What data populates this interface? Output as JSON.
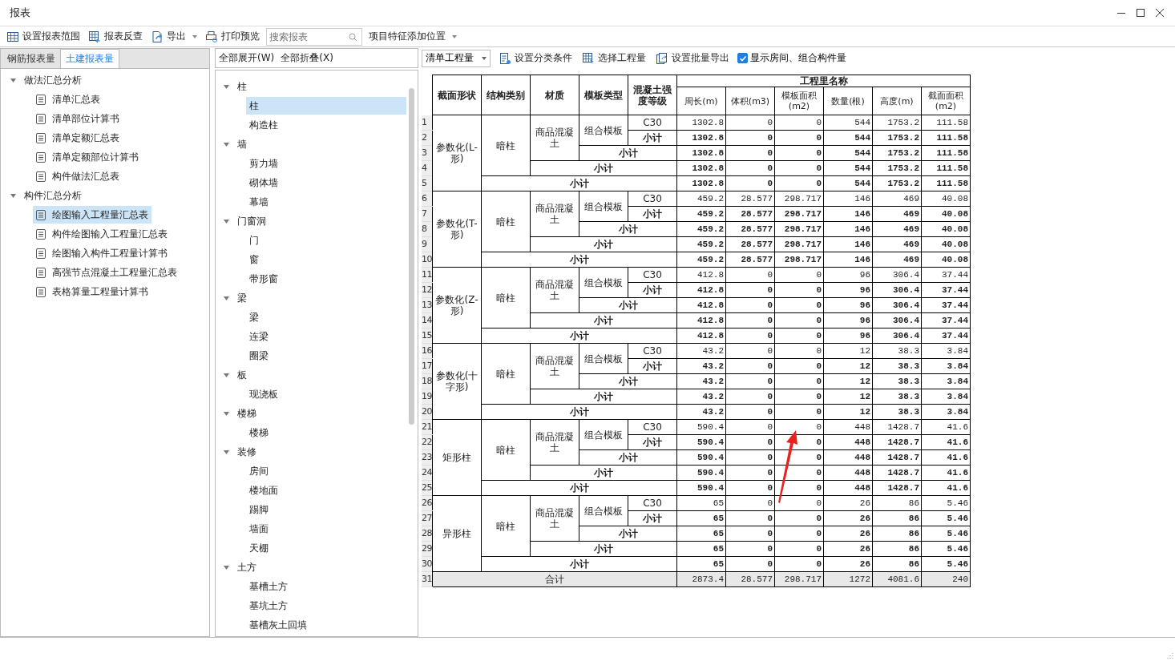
{
  "window": {
    "title": "报表"
  },
  "toolbar": [
    {
      "kind": "button",
      "label": "设置报表范围"
    },
    {
      "kind": "button",
      "label": "报表反查"
    },
    {
      "kind": "menu",
      "label": "导出"
    },
    {
      "kind": "button",
      "label": "打印预览"
    },
    {
      "kind": "search",
      "placeholder": "搜索报表"
    },
    {
      "kind": "dropdown",
      "label": "项目特征添加位置"
    }
  ],
  "left_tabs": [
    {
      "label": "钢筋报表量",
      "selected": false
    },
    {
      "label": "土建报表量",
      "selected": true
    }
  ],
  "report_tree": [
    {
      "label": "做法汇总分析",
      "expanded": true,
      "selected": false,
      "children": [
        {
          "label": "清单汇总表",
          "selected": false
        },
        {
          "label": "清单部位计算书",
          "selected": false
        },
        {
          "label": "清单定额汇总表",
          "selected": false
        },
        {
          "label": "清单定额部位计算书",
          "selected": false
        },
        {
          "label": "构件做法汇总表",
          "selected": false
        }
      ]
    },
    {
      "label": "构件汇总分析",
      "expanded": true,
      "selected": false,
      "children": [
        {
          "label": "绘图输入工程量汇总表",
          "selected": true
        },
        {
          "label": "构件绘图输入工程量汇总表",
          "selected": false
        },
        {
          "label": "绘图输入构件工程量计算书",
          "selected": false
        },
        {
          "label": "高强节点混凝土工程量汇总表",
          "selected": false
        },
        {
          "label": "表格算量工程量计算书",
          "selected": false
        }
      ]
    }
  ],
  "tree_actions": [
    "全部展开(W)",
    "全部折叠(X)"
  ],
  "component_tree": [
    {
      "label": "柱",
      "expanded": true,
      "selected": false,
      "children": [
        {
          "label": "柱",
          "selected": true
        },
        {
          "label": "构造柱",
          "selected": false
        }
      ]
    },
    {
      "label": "墙",
      "expanded": true,
      "selected": false,
      "children": [
        {
          "label": "剪力墙",
          "selected": false
        },
        {
          "label": "砌体墙",
          "selected": false
        },
        {
          "label": "幕墙",
          "selected": false
        }
      ]
    },
    {
      "label": "门窗洞",
      "expanded": true,
      "selected": false,
      "children": [
        {
          "label": "门",
          "selected": false
        },
        {
          "label": "窗",
          "selected": false
        },
        {
          "label": "带形窗",
          "selected": false
        }
      ]
    },
    {
      "label": "梁",
      "expanded": true,
      "selected": false,
      "children": [
        {
          "label": "梁",
          "selected": false
        },
        {
          "label": "连梁",
          "selected": false
        },
        {
          "label": "圈梁",
          "selected": false
        }
      ]
    },
    {
      "label": "板",
      "expanded": true,
      "selected": false,
      "children": [
        {
          "label": "现浇板",
          "selected": false
        }
      ]
    },
    {
      "label": "楼梯",
      "expanded": true,
      "selected": false,
      "children": [
        {
          "label": "楼梯",
          "selected": false
        }
      ]
    },
    {
      "label": "装修",
      "expanded": true,
      "selected": false,
      "children": [
        {
          "label": "房间",
          "selected": false
        },
        {
          "label": "楼地面",
          "selected": false
        },
        {
          "label": "踢脚",
          "selected": false
        },
        {
          "label": "墙面",
          "selected": false
        },
        {
          "label": "天棚",
          "selected": false
        }
      ]
    },
    {
      "label": "土方",
      "expanded": true,
      "selected": false,
      "children": [
        {
          "label": "基槽土方",
          "selected": false
        },
        {
          "label": "基坑土方",
          "selected": false
        },
        {
          "label": "基槽灰土回填",
          "selected": false
        }
      ]
    }
  ],
  "report_toolbar": [
    {
      "kind": "dropdown",
      "label": "清单工程量"
    },
    {
      "kind": "button",
      "label": "设置分类条件"
    },
    {
      "kind": "button",
      "label": "选择工程量"
    },
    {
      "kind": "button",
      "label": "设置批量导出"
    },
    {
      "kind": "checkbox",
      "label": "显示房间、组合构件量",
      "checked": true
    }
  ],
  "table": {
    "columns": [
      "截面形状",
      "结构类别",
      "材质",
      "模板类型",
      "混凝土强度等级"
    ],
    "group_header": "工程里名称",
    "quantity_columns": [
      "周长(m)",
      "体积(m3)",
      "模板面积(m2)",
      "数量(根)",
      "高度(m)",
      "截面面积(m2)"
    ],
    "groups": [
      {
        "shape": "参数化(L-形)",
        "structure": "暗柱",
        "material": "商品混凝土",
        "template": "组合模板",
        "rows": [
          {
            "num": "1",
            "kind": "detail",
            "label": "C30",
            "values": [
              "1302.8",
              "0",
              "0",
              "544",
              "1753.2",
              "111.58"
            ]
          },
          {
            "num": "2",
            "kind": "subtotal",
            "label": "小计",
            "values": [
              "1302.8",
              "0",
              "0",
              "544",
              "1753.2",
              "111.58"
            ]
          },
          {
            "num": "3",
            "kind": "subtotal",
            "label": "小计",
            "values": [
              "1302.8",
              "0",
              "0",
              "544",
              "1753.2",
              "111.58"
            ]
          },
          {
            "num": "4",
            "kind": "subtotal",
            "label": "小计",
            "values": [
              "1302.8",
              "0",
              "0",
              "544",
              "1753.2",
              "111.58"
            ]
          },
          {
            "num": "5",
            "kind": "subtotal",
            "label": "小计",
            "values": [
              "1302.8",
              "0",
              "0",
              "544",
              "1753.2",
              "111.58"
            ]
          }
        ]
      },
      {
        "shape": "参数化(T-形)",
        "structure": "暗柱",
        "material": "商品混凝土",
        "template": "组合模板",
        "rows": [
          {
            "num": "6",
            "kind": "detail",
            "label": "C30",
            "values": [
              "459.2",
              "28.577",
              "298.717",
              "146",
              "469",
              "40.08"
            ]
          },
          {
            "num": "7",
            "kind": "subtotal",
            "label": "小计",
            "values": [
              "459.2",
              "28.577",
              "298.717",
              "146",
              "469",
              "40.08"
            ]
          },
          {
            "num": "8",
            "kind": "subtotal",
            "label": "小计",
            "values": [
              "459.2",
              "28.577",
              "298.717",
              "146",
              "469",
              "40.08"
            ]
          },
          {
            "num": "9",
            "kind": "subtotal",
            "label": "小计",
            "values": [
              "459.2",
              "28.577",
              "298.717",
              "146",
              "469",
              "40.08"
            ]
          },
          {
            "num": "10",
            "kind": "subtotal",
            "label": "小计",
            "values": [
              "459.2",
              "28.577",
              "298.717",
              "146",
              "469",
              "40.08"
            ]
          }
        ]
      },
      {
        "shape": "参数化(Z-形)",
        "structure": "暗柱",
        "material": "商品混凝土",
        "template": "组合模板",
        "rows": [
          {
            "num": "11",
            "kind": "detail",
            "label": "C30",
            "values": [
              "412.8",
              "0",
              "0",
              "96",
              "306.4",
              "37.44"
            ]
          },
          {
            "num": "12",
            "kind": "subtotal",
            "label": "小计",
            "values": [
              "412.8",
              "0",
              "0",
              "96",
              "306.4",
              "37.44"
            ]
          },
          {
            "num": "13",
            "kind": "subtotal",
            "label": "小计",
            "values": [
              "412.8",
              "0",
              "0",
              "96",
              "306.4",
              "37.44"
            ]
          },
          {
            "num": "14",
            "kind": "subtotal",
            "label": "小计",
            "values": [
              "412.8",
              "0",
              "0",
              "96",
              "306.4",
              "37.44"
            ]
          },
          {
            "num": "15",
            "kind": "subtotal",
            "label": "小计",
            "values": [
              "412.8",
              "0",
              "0",
              "96",
              "306.4",
              "37.44"
            ]
          }
        ]
      },
      {
        "shape": "参数化(十字形)",
        "structure": "暗柱",
        "material": "商品混凝土",
        "template": "组合模板",
        "rows": [
          {
            "num": "16",
            "kind": "detail",
            "label": "C30",
            "values": [
              "43.2",
              "0",
              "0",
              "12",
              "38.3",
              "3.84"
            ]
          },
          {
            "num": "17",
            "kind": "subtotal",
            "label": "小计",
            "values": [
              "43.2",
              "0",
              "0",
              "12",
              "38.3",
              "3.84"
            ]
          },
          {
            "num": "18",
            "kind": "subtotal",
            "label": "小计",
            "values": [
              "43.2",
              "0",
              "0",
              "12",
              "38.3",
              "3.84"
            ]
          },
          {
            "num": "19",
            "kind": "subtotal",
            "label": "小计",
            "values": [
              "43.2",
              "0",
              "0",
              "12",
              "38.3",
              "3.84"
            ]
          },
          {
            "num": "20",
            "kind": "subtotal",
            "label": "小计",
            "values": [
              "43.2",
              "0",
              "0",
              "12",
              "38.3",
              "3.84"
            ]
          }
        ]
      },
      {
        "shape": "矩形柱",
        "structure": "暗柱",
        "material": "商品混凝土",
        "template": "组合模板",
        "rows": [
          {
            "num": "21",
            "kind": "detail",
            "label": "C30",
            "values": [
              "590.4",
              "0",
              "0",
              "448",
              "1428.7",
              "41.6"
            ]
          },
          {
            "num": "22",
            "kind": "subtotal",
            "label": "小计",
            "values": [
              "590.4",
              "0",
              "0",
              "448",
              "1428.7",
              "41.6"
            ]
          },
          {
            "num": "23",
            "kind": "subtotal",
            "label": "小计",
            "values": [
              "590.4",
              "0",
              "0",
              "448",
              "1428.7",
              "41.6"
            ]
          },
          {
            "num": "24",
            "kind": "subtotal",
            "label": "小计",
            "values": [
              "590.4",
              "0",
              "0",
              "448",
              "1428.7",
              "41.6"
            ]
          },
          {
            "num": "25",
            "kind": "subtotal",
            "label": "小计",
            "values": [
              "590.4",
              "0",
              "0",
              "448",
              "1428.7",
              "41.6"
            ]
          }
        ]
      },
      {
        "shape": "异形柱",
        "structure": "暗柱",
        "material": "商品混凝土",
        "template": "组合模板",
        "rows": [
          {
            "num": "26",
            "kind": "detail",
            "label": "C30",
            "values": [
              "65",
              "0",
              "0",
              "26",
              "86",
              "5.46"
            ]
          },
          {
            "num": "27",
            "kind": "subtotal",
            "label": "小计",
            "values": [
              "65",
              "0",
              "0",
              "26",
              "86",
              "5.46"
            ]
          },
          {
            "num": "28",
            "kind": "subtotal",
            "label": "小计",
            "values": [
              "65",
              "0",
              "0",
              "26",
              "86",
              "5.46"
            ]
          },
          {
            "num": "29",
            "kind": "subtotal",
            "label": "小计",
            "values": [
              "65",
              "0",
              "0",
              "26",
              "86",
              "5.46"
            ]
          },
          {
            "num": "30",
            "kind": "subtotal",
            "label": "小计",
            "values": [
              "65",
              "0",
              "0",
              "26",
              "86",
              "5.46"
            ]
          }
        ]
      }
    ],
    "total": {
      "num": "31",
      "label": "合计",
      "values": [
        "2873.4",
        "28.577",
        "298.717",
        "1272",
        "4081.6",
        "240"
      ]
    }
  }
}
